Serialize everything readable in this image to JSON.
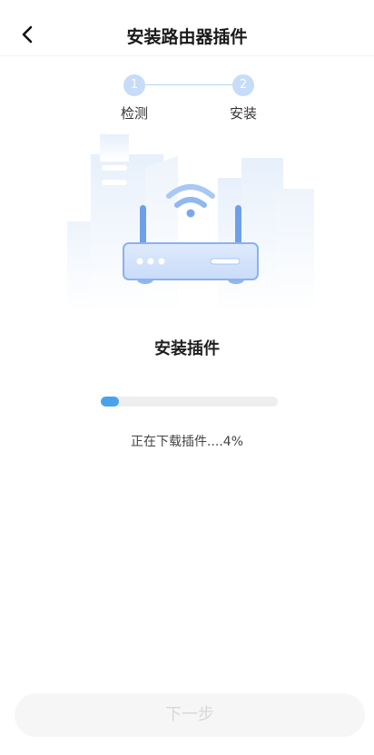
{
  "header": {
    "title": "安装路由器插件",
    "back_icon": "chevron-left-icon"
  },
  "stepper": {
    "steps": [
      {
        "number": "1",
        "label": "检测"
      },
      {
        "number": "2",
        "label": "安装"
      }
    ]
  },
  "main": {
    "title": "安装插件",
    "progress": {
      "percent": 4,
      "text": "正在下载插件....4%"
    }
  },
  "footer": {
    "next_label": "下一步"
  },
  "colors": {
    "accent": "#4aa3ea",
    "step_circle": "#c6dcf8",
    "router_body": "#d6e7fb",
    "button_disabled_bg": "#f6f6f6",
    "button_disabled_text": "#d8d8d8"
  }
}
